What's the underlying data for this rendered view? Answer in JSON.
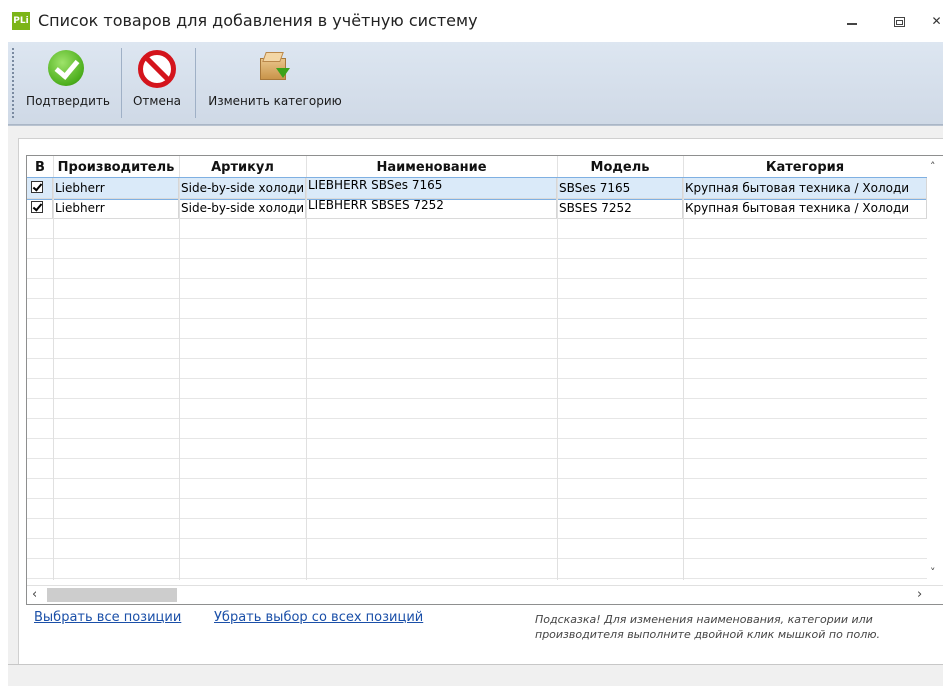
{
  "window": {
    "icon_text": "PLi",
    "title": "Список товаров для добавления в учётную систему"
  },
  "toolbar": {
    "confirm_label": "Подтвердить",
    "cancel_label": "Отмена",
    "change_category_label": "Изменить категорию"
  },
  "grid": {
    "columns": [
      "В",
      "Производитель",
      "Артикул",
      "Наименование",
      "Модель",
      "Категория"
    ],
    "rows": [
      {
        "checked": true,
        "manufacturer": "Liebherr",
        "article": "Side-by-side холоди",
        "name": "LIEBHERR SBSes 7165",
        "model": "SBSes 7165",
        "category": "Крупная бытовая техника / Холоди"
      },
      {
        "checked": true,
        "manufacturer": "Liebherr",
        "article": "Side-by-side холоди",
        "name": "LIEBHERR SBSES 7252",
        "model": "SBSES 7252",
        "category": "Крупная бытовая техника / Холоди"
      }
    ]
  },
  "links": {
    "select_all": "Выбрать все позиции",
    "deselect_all": "Убрать выбор со всех позиций"
  },
  "hint": {
    "line1": "Подсказка! Для изменения наименования, категории или",
    "line2": "производителя выполните двойной клик мышкой по полю."
  }
}
